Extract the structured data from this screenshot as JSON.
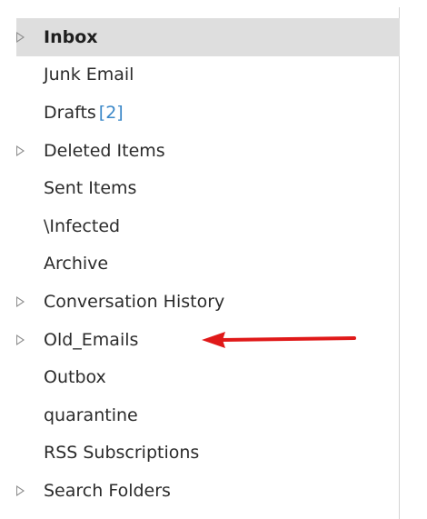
{
  "folders": [
    {
      "label": "Inbox",
      "expandable": true,
      "selected": true,
      "icon": "expander-triangle-icon"
    },
    {
      "label": "Junk Email",
      "expandable": false
    },
    {
      "label": "Drafts",
      "count": "[2]",
      "expandable": false
    },
    {
      "label": "Deleted Items",
      "expandable": true,
      "icon": "expander-triangle-icon"
    },
    {
      "label": "Sent Items",
      "expandable": false
    },
    {
      "label": "\\Infected",
      "expandable": false
    },
    {
      "label": "Archive",
      "expandable": false
    },
    {
      "label": "Conversation History",
      "expandable": true,
      "icon": "expander-triangle-icon"
    },
    {
      "label": "Old_Emails",
      "expandable": true,
      "icon": "expander-triangle-icon"
    },
    {
      "label": "Outbox",
      "expandable": false
    },
    {
      "label": "quarantine",
      "expandable": false
    },
    {
      "label": "RSS Subscriptions",
      "expandable": false
    },
    {
      "label": "Search Folders",
      "expandable": true,
      "icon": "expander-triangle-icon"
    }
  ],
  "annotation": {
    "icon": "red-arrow-icon",
    "color": "#e01919",
    "points_to": "Old_Emails"
  },
  "colors": {
    "selected_background": "#dedede",
    "unread_count": "#3a87c8",
    "text": "#2b2b2b"
  }
}
